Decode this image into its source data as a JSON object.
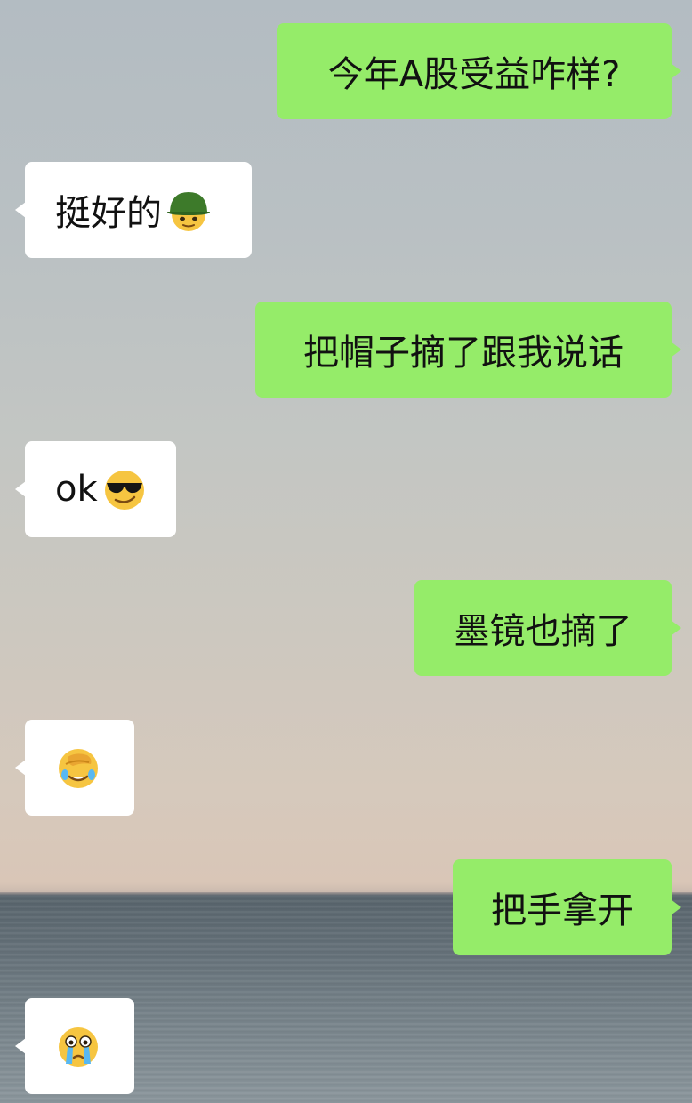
{
  "messages": [
    {
      "side": "out",
      "text": "今年A股受益咋样?"
    },
    {
      "side": "in",
      "text": "挺好的",
      "emoji": "helmet-emoji-icon"
    },
    {
      "side": "out",
      "text": "把帽子摘了跟我说话"
    },
    {
      "side": "in",
      "text": "ok",
      "emoji": "sunglasses-emoji-icon"
    },
    {
      "side": "out",
      "text": "墨镜也摘了"
    },
    {
      "side": "in",
      "text": "",
      "emoji": "facepalm-emoji-icon"
    },
    {
      "side": "out",
      "text": "把手拿开"
    },
    {
      "side": "in",
      "text": "",
      "emoji": "crying-emoji-icon"
    }
  ],
  "colors": {
    "outgoing_bubble": "#95ec69",
    "incoming_bubble": "#ffffff",
    "text": "#111111"
  }
}
